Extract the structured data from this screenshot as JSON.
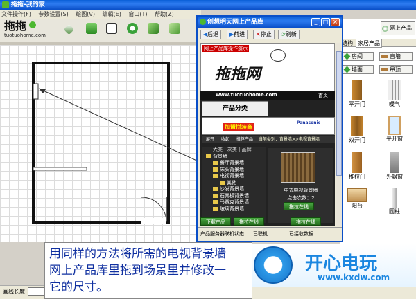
{
  "main": {
    "title": "拖拖-我的家",
    "menu": [
      "文件操作(F)",
      "参数设置(S)",
      "绘图(V)",
      "编辑(E)",
      "窗口(T)",
      "帮助(Z)"
    ],
    "logo_url": "tuotuohome.com",
    "right_tabs": [
      "结构",
      "家居产品"
    ],
    "panel_header": "网上产品",
    "categories": [
      "房间",
      "直墙",
      "墙面",
      "吊顶"
    ],
    "products": [
      "平开门",
      "暖气",
      "双开门",
      "平开窗",
      "推拉门",
      "外飘窗",
      "阳台",
      "圆柱"
    ],
    "status_label": "画线长度"
  },
  "browser": {
    "title": "创想明天网上产品库",
    "nav": {
      "back": "后退",
      "forward": "前进",
      "stop": "停止",
      "refresh": "刷新"
    },
    "banner_tag": "网上产品库操作演示",
    "brand": "拖拖网",
    "site_url": "www.tuotuohome.com",
    "home_link": "首页",
    "category_title": "产品分类",
    "ad_label": "加盟拼装商",
    "ad_brand": "Panasonic",
    "tabs": [
      "展开",
      "收起",
      "推荐产品"
    ],
    "breadcrumb": "当前类别：背景墙>>电视背景墙",
    "tree_header": [
      "大类",
      "次类",
      "品牌"
    ],
    "tree": [
      "背景墙",
      "餐厅背景墙",
      "床头背景墙",
      "电视背景墙",
      "其他",
      "沙发背景墙",
      "石膏板背景墙",
      "马赛克背景墙",
      "玻璃背景墙"
    ],
    "product_name": "中式电视背景墙",
    "product_clicks": "点击次数：2",
    "drag_btn": "拖拉在线",
    "side_btn": "下载产品",
    "status": [
      "产品服务器联机状态",
      "已联机",
      "已接收数据"
    ]
  },
  "caption": {
    "line1": "用同样的方法将所需的电视背景墙",
    "line2": "网上产品库里拖到场景里并修改一",
    "line3": "它的尺寸。"
  },
  "watermark": {
    "cn": "开心电玩",
    "url": "www.kxdw.com"
  }
}
